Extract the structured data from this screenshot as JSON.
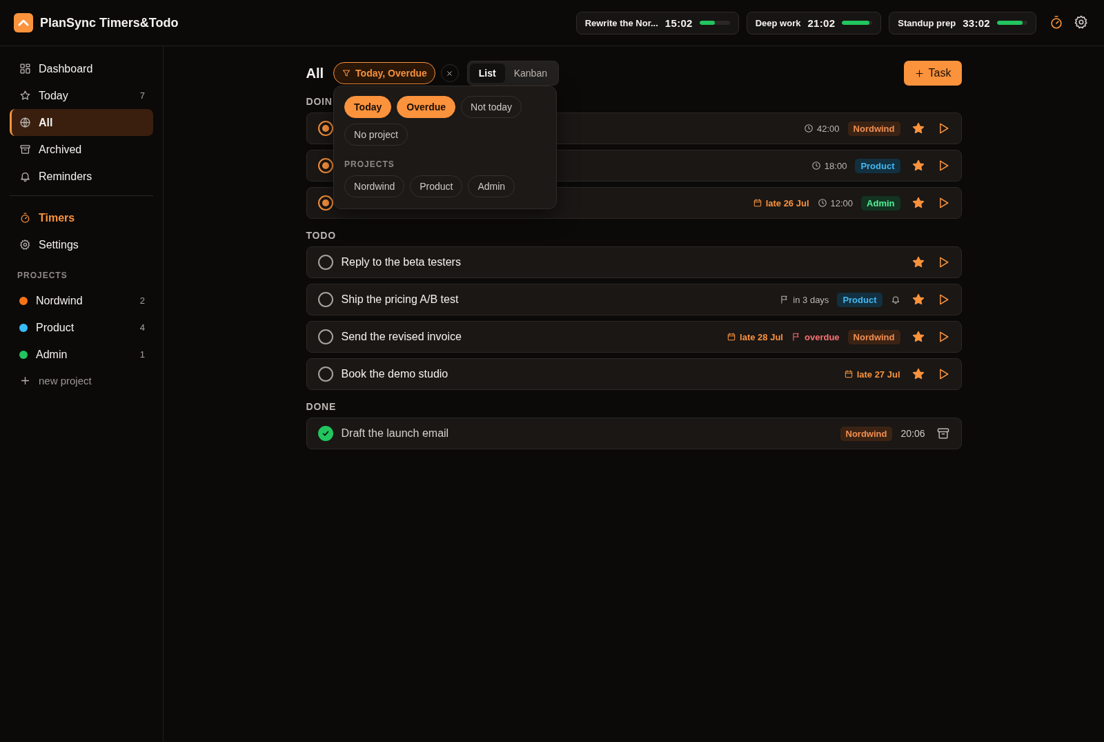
{
  "app": {
    "title": "PlanSync Timers&Todo"
  },
  "timers": [
    {
      "name": "Rewrite the Nor...",
      "time": "15:02",
      "level": 0.5
    },
    {
      "name": "Deep work",
      "time": "21:02",
      "level": 0.9
    },
    {
      "name": "Standup prep",
      "time": "33:02",
      "level": 0.85
    }
  ],
  "sidebar": {
    "items": [
      {
        "label": "Dashboard",
        "selected": false
      },
      {
        "label": "Today",
        "count": "7",
        "selected": false
      },
      {
        "label": "All",
        "selected": true
      },
      {
        "label": "Archived",
        "selected": false
      },
      {
        "label": "Reminders",
        "selected": false
      }
    ],
    "tools": [
      {
        "label": "Timers",
        "active": true
      },
      {
        "label": "Settings",
        "active": false
      }
    ],
    "projects_heading": "PROJECTS",
    "projects": [
      {
        "name": "Nordwind",
        "count": "2",
        "color": "#f97316"
      },
      {
        "name": "Product",
        "count": "4",
        "color": "#38bdf8"
      },
      {
        "name": "Admin",
        "count": "1",
        "color": "#22c55e"
      }
    ],
    "new_project": "new project"
  },
  "toolbar": {
    "title": "All",
    "filter": "Today, Overdue",
    "views": [
      {
        "label": "List",
        "selected": true
      },
      {
        "label": "Kanban",
        "selected": false
      }
    ],
    "add_button": "Task"
  },
  "filter_popover": {
    "chips": [
      {
        "label": "Today",
        "selected": true
      },
      {
        "label": "Overdue",
        "selected": true
      },
      {
        "label": "Not today",
        "selected": false
      },
      {
        "label": "No project",
        "selected": false
      }
    ],
    "projects_heading": "PROJECTS",
    "projects": [
      {
        "label": "Nordwind",
        "selected": false
      },
      {
        "label": "Product",
        "selected": false
      },
      {
        "label": "Admin",
        "selected": false
      }
    ]
  },
  "sections": [
    {
      "title": "DOIN",
      "tasks": [
        {
          "checked": false,
          "in_progress": true,
          "meta": [
            {
              "kind": "time",
              "text": "42:00"
            },
            {
              "kind": "tag",
              "text": "Nordwind",
              "color": "#3b2314"
            }
          ],
          "starred": true
        },
        {
          "checked": false,
          "in_progress": true,
          "meta": [
            {
              "kind": "time",
              "text": "18:00"
            },
            {
              "kind": "tag",
              "text": "Product",
              "color": "#12303f"
            }
          ],
          "starred": true
        },
        {
          "checked": false,
          "in_progress": true,
          "meta": [
            {
              "kind": "date",
              "text": "late 26 Jul"
            },
            {
              "kind": "time",
              "text": "12:00"
            },
            {
              "kind": "tag",
              "text": "Admin",
              "color": "#123421"
            }
          ],
          "starred": true
        }
      ]
    },
    {
      "title": "TODO",
      "tasks": [
        {
          "checked": false,
          "in_progress": false,
          "title": "Reply to the beta testers",
          "starred": true
        },
        {
          "checked": false,
          "in_progress": false,
          "title": "Ship the pricing A/B test",
          "meta": [
            {
              "kind": "deadline",
              "text": "in 3 days",
              "overdue": false
            },
            {
              "kind": "tag",
              "text": "Product",
              "color": "#12303f"
            },
            {
              "kind": "reminder"
            }
          ],
          "starred": true
        },
        {
          "checked": false,
          "in_progress": false,
          "title": "Send the revised invoice",
          "meta": [
            {
              "kind": "date",
              "text": "late 28 Jul"
            },
            {
              "kind": "deadline",
              "text": "overdue",
              "overdue": true
            },
            {
              "kind": "tag",
              "text": "Nordwind",
              "color": "#3b2314"
            }
          ],
          "starred": true
        },
        {
          "checked": false,
          "in_progress": false,
          "title": "Book the demo studio",
          "meta": [
            {
              "kind": "date",
              "text": "late 27 Jul"
            }
          ],
          "starred": true
        }
      ]
    },
    {
      "title": "DONE",
      "tasks": [
        {
          "checked": true,
          "title": "Draft the launch email",
          "meta": [
            {
              "kind": "tag",
              "text": "Nordwind",
              "color": "#3b2314"
            },
            {
              "kind": "spent",
              "text": "20:06"
            }
          ],
          "starred": false
        }
      ]
    }
  ]
}
